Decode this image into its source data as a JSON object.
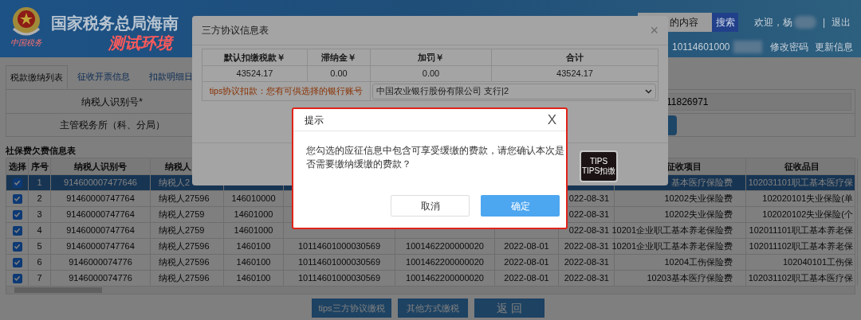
{
  "header": {
    "title": "国家税务总局海南",
    "subtitle": "测试环境",
    "emblem_caption": "中国税务",
    "search": {
      "value": "的内容",
      "button": "搜索"
    },
    "welcome": "欢迎，杨",
    "separator": "|",
    "logout": "退出",
    "account": "10114601000",
    "links": [
      "修改密码",
      "更新信息"
    ]
  },
  "tabs": [
    {
      "label": "税款缴纳列表",
      "selected": true
    },
    {
      "label": "征收开票信息",
      "selected": false
    },
    {
      "label": "扣款明细日",
      "selected": false
    }
  ],
  "form": [
    {
      "kind": "text",
      "label": "纳税人识别号*",
      "value": "11826971"
    },
    {
      "kind": "button",
      "label": "主管税务所（科、分局）"
    }
  ],
  "arrears_table": {
    "title": "社保费欠费信息表",
    "columns": [
      "选择",
      "序号",
      "纳税人识别号",
      "纳税人",
      null,
      null,
      null,
      null,
      null,
      "征收项目",
      "征收品目"
    ],
    "rows": [
      {
        "checked": true,
        "selected": true,
        "cells": [
          null,
          "1",
          "914600007477646",
          "纳税人2",
          null,
          null,
          null,
          null,
          null,
          "基本医疗保险费",
          "102031101职工基本医疗保"
        ]
      },
      {
        "checked": true,
        "selected": false,
        "cells": [
          null,
          "2",
          "91460000747764",
          "纳税人27596",
          "146010000",
          null,
          null,
          null,
          "022-08-31",
          "10202失业保险费",
          "102020101失业保险(单"
        ]
      },
      {
        "checked": true,
        "selected": false,
        "cells": [
          null,
          "3",
          "91460000747764",
          "纳税人2759",
          "14601000",
          null,
          null,
          null,
          "022-08-31",
          "10202失业保险费",
          "102020102失业保险(个"
        ]
      },
      {
        "checked": true,
        "selected": false,
        "cells": [
          null,
          "4",
          "91460000747764",
          "纳税人2759",
          "14601000",
          null,
          null,
          null,
          "022-08-31",
          "10201企业职工基本养老保险费",
          "102011101职工基本养老保"
        ]
      },
      {
        "checked": true,
        "selected": false,
        "cells": [
          null,
          "5",
          "91460000747764",
          "纳税人27596",
          "1460100",
          "10114601000030569",
          "1001462200000020",
          "2022-08-01",
          "2022-08-31",
          "10201企业职工基本养老保险费",
          "102011102职工基本养老保"
        ]
      },
      {
        "checked": true,
        "selected": false,
        "cells": [
          null,
          "6",
          "9146000074776",
          "纳税人27596",
          "1460100",
          "10114601000030569",
          "1001462200000020",
          "2022-08-01",
          "2022-08-31",
          "10204工伤保险费",
          "102040101工伤保"
        ]
      },
      {
        "checked": true,
        "selected": false,
        "cells": [
          null,
          "7",
          "9146000074776",
          "纳税人27596",
          "1460100",
          "10114601000030569",
          "1001462200000020",
          "2022-08-01",
          "2022-08-31",
          "10203基本医疗保险费",
          "102031102职工基本医疗保"
        ]
      }
    ]
  },
  "buttons": [
    "tips三方协议缴税",
    "其他方式缴税",
    "返 回"
  ],
  "agreement_dialog": {
    "title": "三方协议信息表",
    "close": "×",
    "columns": [
      "默认扣缴税款￥",
      "滞纳金￥",
      "加罚￥",
      "合计"
    ],
    "values": [
      "43524.17",
      "0.00",
      "0.00",
      "43524.17"
    ],
    "notice": "tips协议扣款：您有可供选择的银行账号",
    "bank_account": "中国农业银行股份有限公司 支行|2",
    "tips_badge": {
      "label": "TIPS",
      "caption": "TIPS扣缴"
    }
  },
  "prompt": {
    "title": "提示",
    "close": "X",
    "message": "您勾选的应征信息中包含可享受缓缴的费款，请您确认本次是否需要缴纳缓缴的费款？",
    "buttons": [
      {
        "label": "取消",
        "kind": "secondary"
      },
      {
        "label": "确定",
        "kind": "primary"
      }
    ]
  }
}
